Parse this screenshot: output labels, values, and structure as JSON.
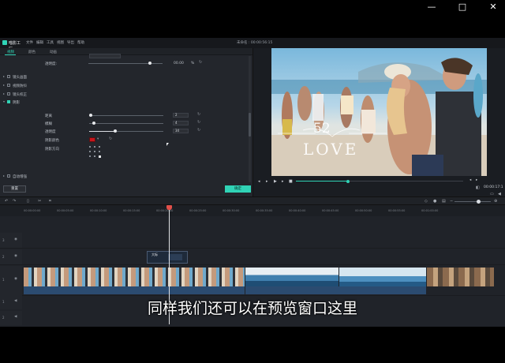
{
  "window": {
    "minimize": "—",
    "maximize": "□",
    "close": "✕"
  },
  "app": {
    "logo_text": "喵影工厂",
    "project_title": "未命名 : 00:00:56:15",
    "menu": [
      "文件",
      "编辑",
      "工具",
      "视图",
      "导出",
      "帮助"
    ]
  },
  "panel": {
    "tabs": [
      "视频",
      "颜色",
      "动画"
    ],
    "partial_row": {
      "label": "透明度:",
      "value": "00.00"
    },
    "unit": "%",
    "sections": [
      {
        "label": "镜头画面",
        "checked": false
      },
      {
        "label": "视频防抖",
        "checked": false
      },
      {
        "label": "镜头校正",
        "checked": false
      },
      {
        "label": "阴影",
        "checked": true
      }
    ],
    "shadow": {
      "distance": {
        "label": "距离",
        "value": "2",
        "fraction": 0.03
      },
      "blur": {
        "label": "模糊",
        "value": "4",
        "fraction": 0.05
      },
      "opacity": {
        "label": "透明度",
        "value": "34",
        "fraction": 0.34
      },
      "color_label": "阴影颜色",
      "color": "#c8161c",
      "direction_label": "阴影方向"
    },
    "auto_enhance": {
      "label": "自动增强",
      "checked": false
    },
    "reset_label": "重置",
    "ok_label": "确定"
  },
  "player": {
    "timecode": "00:00:17:1",
    "progress": 0.31,
    "overlay_number": "52",
    "overlay_word": "LOVE"
  },
  "timeline": {
    "ruler": [
      "00:00:00:00",
      "00:00:05:00",
      "00:00:10:00",
      "00:00:15:00",
      "00:00:20:00",
      "00:00:25:00",
      "00:00:30:00",
      "00:00:35:00",
      "00:00:40:00",
      "00:00:45:00",
      "00:00:50:00",
      "00:00:55:00",
      "00:01:00:00"
    ],
    "tracks": [
      "3",
      "2",
      "1",
      "1",
      "2"
    ],
    "title_clip_label": "大标"
  },
  "subtitle": "同样我们还可以在预览窗口这里",
  "colors": {
    "accent": "#30d3b6",
    "panel": "#23262c",
    "shadow_color": "#c8161c"
  }
}
